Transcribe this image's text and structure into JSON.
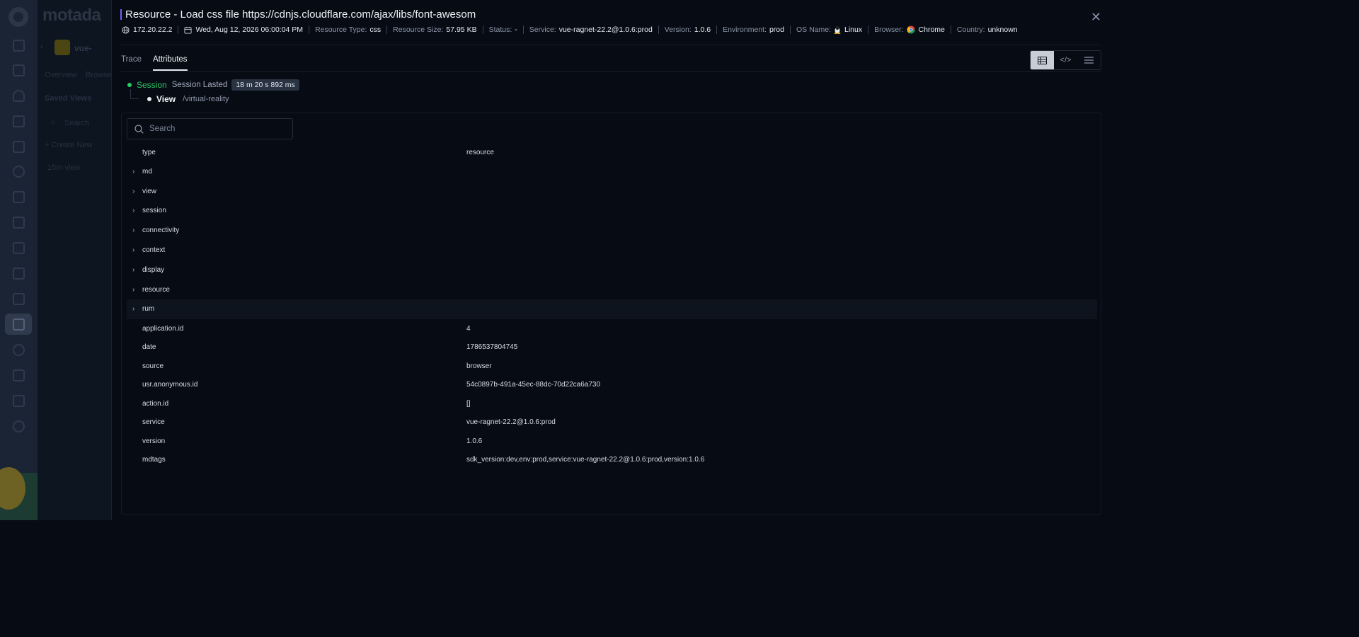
{
  "app": {
    "brand": "motada",
    "project_label": "vue-"
  },
  "subnav": {
    "tabs": [
      "Overview",
      "Browse"
    ],
    "saved_views_label": "Saved Views",
    "search_placeholder": "Search",
    "create_new_label": "+ Create New",
    "views": [
      "15m view"
    ]
  },
  "panel": {
    "title": "Resource - Load css file https://cdnjs.cloudflare.com/ajax/libs/font-awesom",
    "meta": {
      "ip": "172.20.22.2",
      "datetime": "Wed, Aug 12, 2026 06:00:04 PM",
      "resource_type_label": "Resource Type:",
      "resource_type": "css",
      "resource_size_label": "Resource Size:",
      "resource_size": "57.95 KB",
      "status_label": "Status:",
      "status": "-",
      "service_label": "Service:",
      "service": "vue-ragnet-22.2@1.0.6:prod",
      "version_label": "Version:",
      "version": "1.0.6",
      "environment_label": "Environment:",
      "environment": "prod",
      "os_label": "OS Name:",
      "os": "Linux",
      "browser_label": "Browser:",
      "browser": "Chrome",
      "country_label": "Country:",
      "country": "unknown"
    },
    "tabs": [
      {
        "label": "Trace",
        "active": false
      },
      {
        "label": "Attributes",
        "active": true
      }
    ],
    "session": {
      "label": "Session",
      "lasted_text": "Session Lasted",
      "duration": "18 m 20 s 892 ms"
    },
    "view": {
      "label": "View",
      "path": "/virtual-reality"
    },
    "search_placeholder": "Search",
    "attributes": [
      {
        "key": "type",
        "value": "resource",
        "expandable": false
      },
      {
        "key": "md",
        "value": "",
        "expandable": true
      },
      {
        "key": "view",
        "value": "",
        "expandable": true
      },
      {
        "key": "session",
        "value": "",
        "expandable": true
      },
      {
        "key": "connectivity",
        "value": "",
        "expandable": true
      },
      {
        "key": "context",
        "value": "",
        "expandable": true
      },
      {
        "key": "display",
        "value": "",
        "expandable": true
      },
      {
        "key": "resource",
        "value": "",
        "expandable": true
      },
      {
        "key": "rum",
        "value": "",
        "expandable": true
      },
      {
        "key": "application.id",
        "value": "4",
        "expandable": false
      },
      {
        "key": "date",
        "value": "1786537804745",
        "expandable": false
      },
      {
        "key": "source",
        "value": "browser",
        "expandable": false
      },
      {
        "key": "usr.anonymous.id",
        "value": "54c0897b-491a-45ec-88dc-70d22ca6a730",
        "expandable": false
      },
      {
        "key": "action.id",
        "value": "[]",
        "expandable": false
      },
      {
        "key": "service",
        "value": "vue-ragnet-22.2@1.0.6:prod",
        "expandable": false
      },
      {
        "key": "version",
        "value": "1.0.6",
        "expandable": false
      },
      {
        "key": "mdtags",
        "value": "sdk_version:dev,env:prod,service:vue-ragnet-22.2@1.0.6:prod,version:1.0.6",
        "expandable": false
      }
    ]
  },
  "colors": {
    "accent": "#7b5cf0",
    "session_green": "#2ecb63",
    "background": "#060b14"
  }
}
